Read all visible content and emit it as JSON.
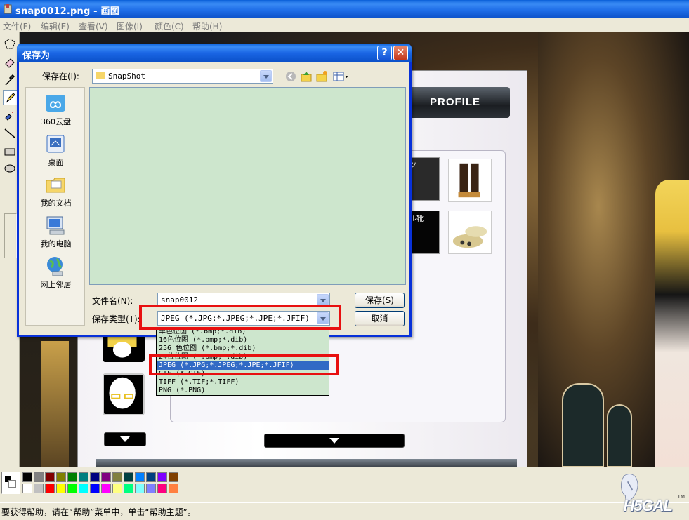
{
  "window": {
    "title": "snap0012.png - 画图"
  },
  "menu": [
    "文件(F)",
    "编辑(E)",
    "查看(V)",
    "图像(I)",
    "颜色(C)",
    "帮助(H)"
  ],
  "game": {
    "profile_label": "PROFILE",
    "item1_text": "ーツ",
    "item2_text": "ルル靴"
  },
  "dialog": {
    "title": "保存为",
    "help_btn": "?",
    "close_btn": "✕",
    "save_in_label": "保存在(I):",
    "save_in_value": "SnapShot",
    "places": [
      "360云盘",
      "桌面",
      "我的文档",
      "我的电脑",
      "网上邻居"
    ],
    "filename_label": "文件名(N):",
    "filename_value": "snap0012",
    "filetype_label": "保存类型(T):",
    "filetype_value": "JPEG (*.JPG;*.JPEG;*.JPE;*.JFIF)",
    "save_button": "保存(S)",
    "cancel_button": "取消",
    "filetype_options": [
      "单色位图 (*.bmp;*.dib)",
      "16色位图 (*.bmp;*.dib)",
      "256 色位图 (*.bmp;*.dib)",
      "24位位图 (*.bmp;*.dib)",
      "JPEG (*.JPG;*.JPEG;*.JPE;*.JFIF)",
      "GIF (*.GIF)",
      "TIFF (*.TIF;*.TIFF)",
      "PNG (*.PNG)"
    ],
    "selected_option_index": 4
  },
  "palette": {
    "row1": [
      "#000000",
      "#808080",
      "#800000",
      "#808000",
      "#008000",
      "#008080",
      "#000080",
      "#800080",
      "#808040",
      "#004040",
      "#0080ff",
      "#004080",
      "#8000ff",
      "#804000"
    ],
    "row2": [
      "#ffffff",
      "#c0c0c0",
      "#ff0000",
      "#ffff00",
      "#00ff00",
      "#00ffff",
      "#0000ff",
      "#ff00ff",
      "#ffff80",
      "#00ff80",
      "#80ffff",
      "#8080ff",
      "#ff0080",
      "#ff8040"
    ]
  },
  "status": {
    "text": "要获得帮助，请在“帮助”菜单中，单击“帮助主题”。"
  },
  "watermark": {
    "logo_text": "H5GAL",
    "tm": "TM"
  },
  "colors": {
    "highlight_red": "#e81010",
    "list_bg": "#cde6cd",
    "selection_blue": "#316ac5",
    "xp_blue": "#0a5fd8"
  }
}
